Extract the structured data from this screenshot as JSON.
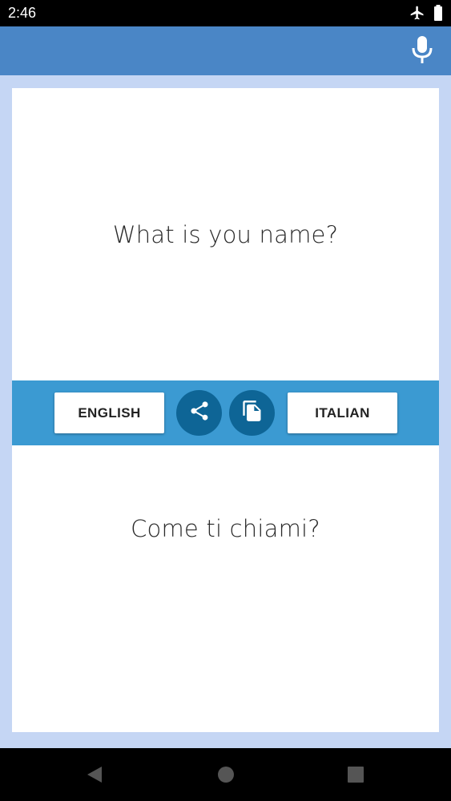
{
  "status_bar": {
    "time": "2:46",
    "icons": [
      "airplane-mode-icon",
      "battery-icon"
    ]
  },
  "app_bar": {
    "mic_icon": "microphone-icon"
  },
  "source": {
    "text": "What is you name?"
  },
  "toolbar": {
    "source_language": "ENGLISH",
    "target_language": "ITALIAN",
    "share_icon": "share-icon",
    "copy_icon": "copy-icon"
  },
  "target": {
    "text": "Come ti chiami?"
  },
  "nav_bar": {
    "icons": [
      "back-icon",
      "home-icon",
      "recents-icon"
    ]
  },
  "colors": {
    "app_bar": "#4a86c6",
    "toolbar": "#3b9ad2",
    "circle_button": "#0e6596",
    "background": "#c5d6f4"
  }
}
